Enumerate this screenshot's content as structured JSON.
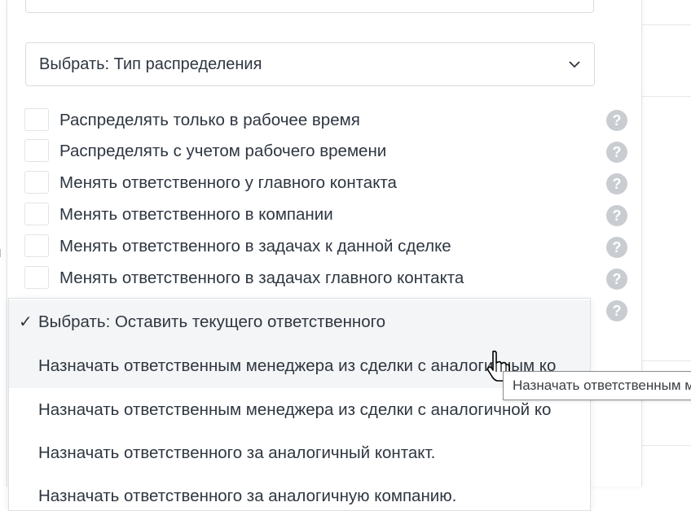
{
  "top_input": {
    "partial_text": ""
  },
  "distribution_select": {
    "label": "Выбрать: Тип распределения",
    "chevron_icon": "chevron-down-icon"
  },
  "options": [
    {
      "label": "Распределять только в рабочее время",
      "checked": false
    },
    {
      "label": "Распределять с учетом рабочего времени",
      "checked": false
    },
    {
      "label": "Менять ответственного у главного контакта",
      "checked": false
    },
    {
      "label": "Менять ответственного в компании",
      "checked": false
    },
    {
      "label": "Менять ответственного в задачах к данной сделке",
      "checked": false
    },
    {
      "label": "Менять ответственного в задачах главного контакта",
      "checked": false
    }
  ],
  "help_icon": "question-circle-icon",
  "dropdown": {
    "items": [
      {
        "label": "Выбрать: Оставить текущего ответственного",
        "selected": true
      },
      {
        "label": "Назначать ответственным менеджера из сделки с аналогичным ко",
        "hover": true
      },
      {
        "label": "Назначать ответственным менеджера из сделки с аналогичной ко"
      },
      {
        "label": "Назначать ответственного за аналогичный контакт."
      },
      {
        "label": "Назначать ответственного за аналогичную компанию."
      }
    ],
    "check_mark": "✓"
  },
  "tooltip": {
    "text": "Назначать ответственным м"
  },
  "colors": {
    "help_icon_bg": "#c9cdd1",
    "text": "#2e3640",
    "border": "#d8dde2"
  }
}
